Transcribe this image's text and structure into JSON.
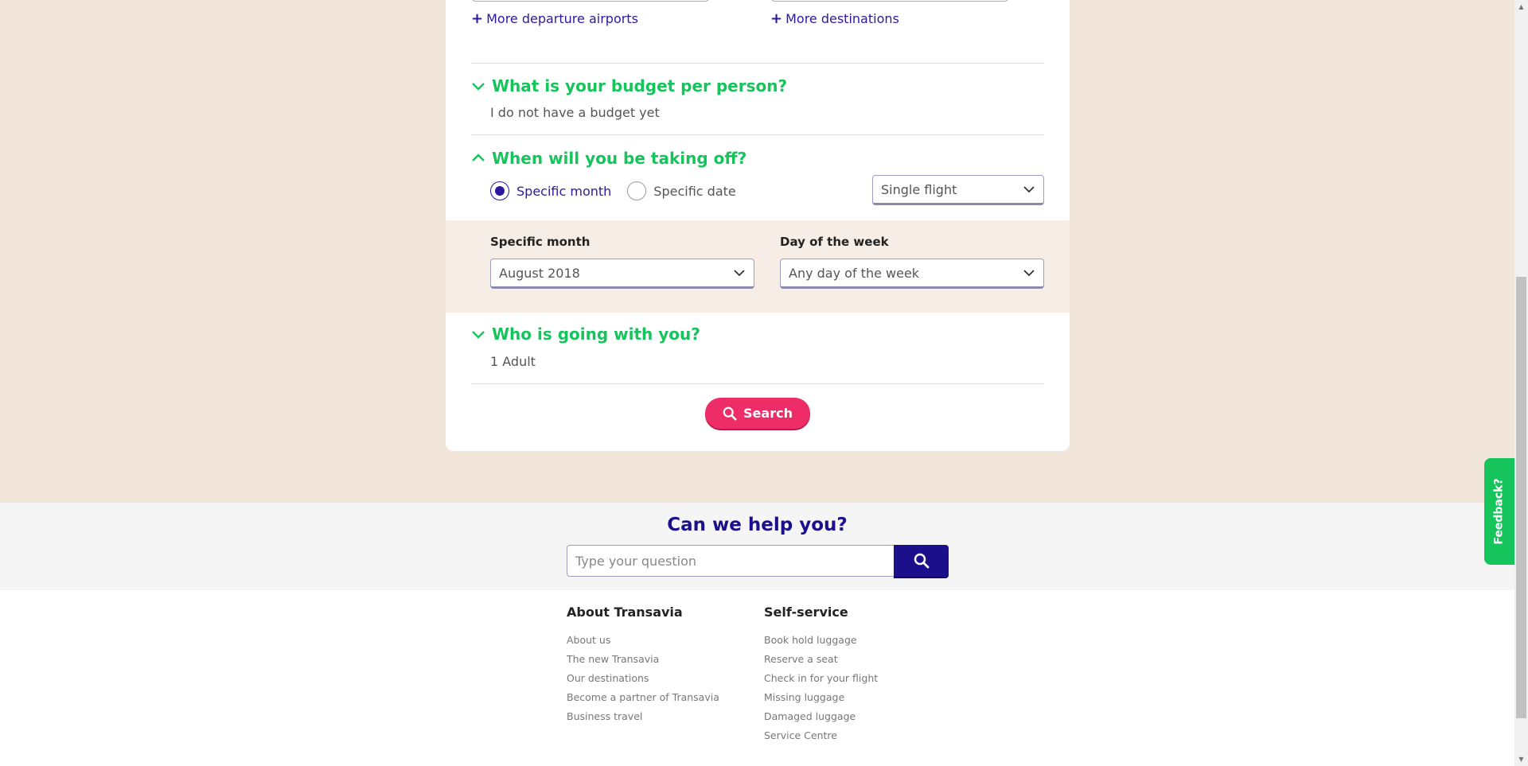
{
  "search_form": {
    "more_departure_label": "More departure airports",
    "more_destinations_label": "More destinations",
    "budget": {
      "heading": "What is your budget per person?",
      "value": "I do not have a budget yet"
    },
    "takeoff": {
      "heading": "When will you be taking off?",
      "radio_month_label": "Specific month",
      "radio_date_label": "Specific date",
      "selected_radio": "Specific month",
      "trip_type_value": "Single flight",
      "month_field_label": "Specific month",
      "month_value": "August 2018",
      "weekday_field_label": "Day of the week",
      "weekday_value": "Any day of the week"
    },
    "travellers": {
      "heading": "Who is going with you?",
      "value": "1 Adult"
    },
    "search_button_label": "Search"
  },
  "help": {
    "title": "Can we help you?",
    "input_placeholder": "Type your question"
  },
  "footer": {
    "about": {
      "heading": "About Transavia",
      "links": [
        "About us",
        "The new Transavia",
        "Our destinations",
        "Become a partner of Transavia",
        "Business travel"
      ]
    },
    "self_service": {
      "heading": "Self-service",
      "links": [
        "Book hold luggage",
        "Reserve a seat",
        "Check in for your flight",
        "Missing luggage",
        "Damaged luggage",
        "Service Centre"
      ]
    }
  },
  "feedback_label": "Feedback?",
  "colors": {
    "page_background": "#f2e5da",
    "accent_green": "#16c45c",
    "brand_blue": "#1b0f8c",
    "search_pink": "#ee2d68"
  },
  "icons": {
    "section_collapsed": "chevron-down-icon",
    "section_expanded": "chevron-up-icon",
    "search": "search-icon",
    "add": "plus-icon"
  }
}
